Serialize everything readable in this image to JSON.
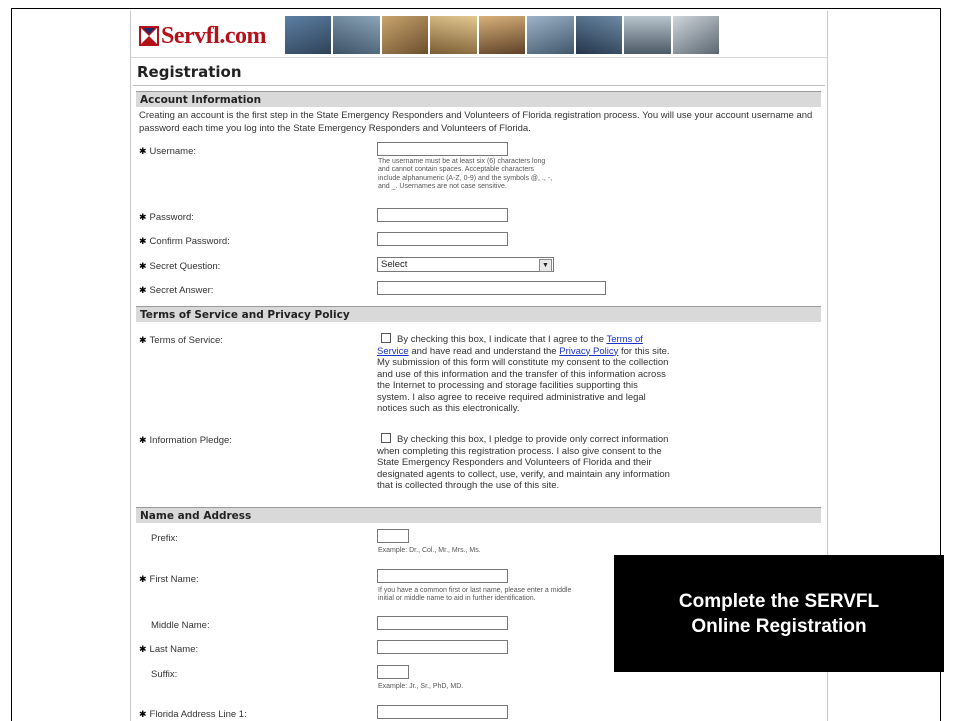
{
  "header": {
    "logo_text": "Servfl.com"
  },
  "page_title": "Registration",
  "sections": {
    "account": "Account Information",
    "terms": "Terms of Service and Privacy Policy",
    "name": "Name and Address"
  },
  "intro": "Creating an account is the first step in the State Emergency Responders and Volunteers of Florida registration process. You will use your account username and password each time you log into the State Emergency Responders and Volunteers of Florida.",
  "fields": {
    "username": {
      "label": "Username:",
      "value": ""
    },
    "username_help": "The username must be at least six (6) characters long and cannot contain spaces. Acceptable characters include alphanumeric (A-Z, 0-9) and the symbols @, ., -, and _. Usernames are not case sensitive.",
    "password": {
      "label": "Password:",
      "value": ""
    },
    "confirm_password": {
      "label": "Confirm Password:",
      "value": ""
    },
    "secret_question": {
      "label": "Secret Question:",
      "selected": "Select"
    },
    "secret_answer": {
      "label": "Secret Answer:",
      "value": ""
    },
    "terms_of_service": {
      "label": "Terms of Service:",
      "text_1": "By checking this box, I indicate that I agree to the ",
      "link_terms": "Terms of Service",
      "text_2": " and have read and understand the ",
      "link_privacy": "Privacy Policy",
      "text_3": " for this site. My submission of this form will constitute my consent to the collection and use of this information and the transfer of this information across the Internet to processing and storage facilities supporting this system. I also agree to receive required administrative and legal notices such as this electronically.",
      "checked": false
    },
    "information_pledge": {
      "label": "Information Pledge:",
      "text": "By checking this box, I pledge to provide only correct information when completing this registration process. I also give consent to the State Emergency Responders and Volunteers of Florida and their designated agents to collect, use, verify, and maintain any information that is collected through the use of this site.",
      "checked": false
    },
    "prefix": {
      "label": "Prefix:",
      "value": ""
    },
    "prefix_help": "Example: Dr., Col., Mr., Mrs., Ms.",
    "first_name": {
      "label": "First Name:",
      "value": ""
    },
    "first_name_help": "If you have a common first or last name, please enter a middle initial or middle name to aid in further identification.",
    "middle_name": {
      "label": "Middle Name:",
      "value": ""
    },
    "last_name": {
      "label": "Last Name:",
      "value": ""
    },
    "suffix": {
      "label": "Suffix:",
      "value": ""
    },
    "suffix_help": "Example: Jr., Sr., PhD, MD.",
    "florida_address_1": {
      "label": "Florida Address Line 1:",
      "value": ""
    }
  },
  "overlay": {
    "line1": "Complete the SERVFL",
    "line2": "Online Registration"
  },
  "colors": {
    "brand_red": "#b3121b",
    "link": "#1a33cc",
    "section_bg": "#d9d9d9"
  },
  "icons": {
    "logo": "red-cross-logo-icon",
    "required": "star-icon",
    "dropdown": "chevron-down-icon"
  }
}
